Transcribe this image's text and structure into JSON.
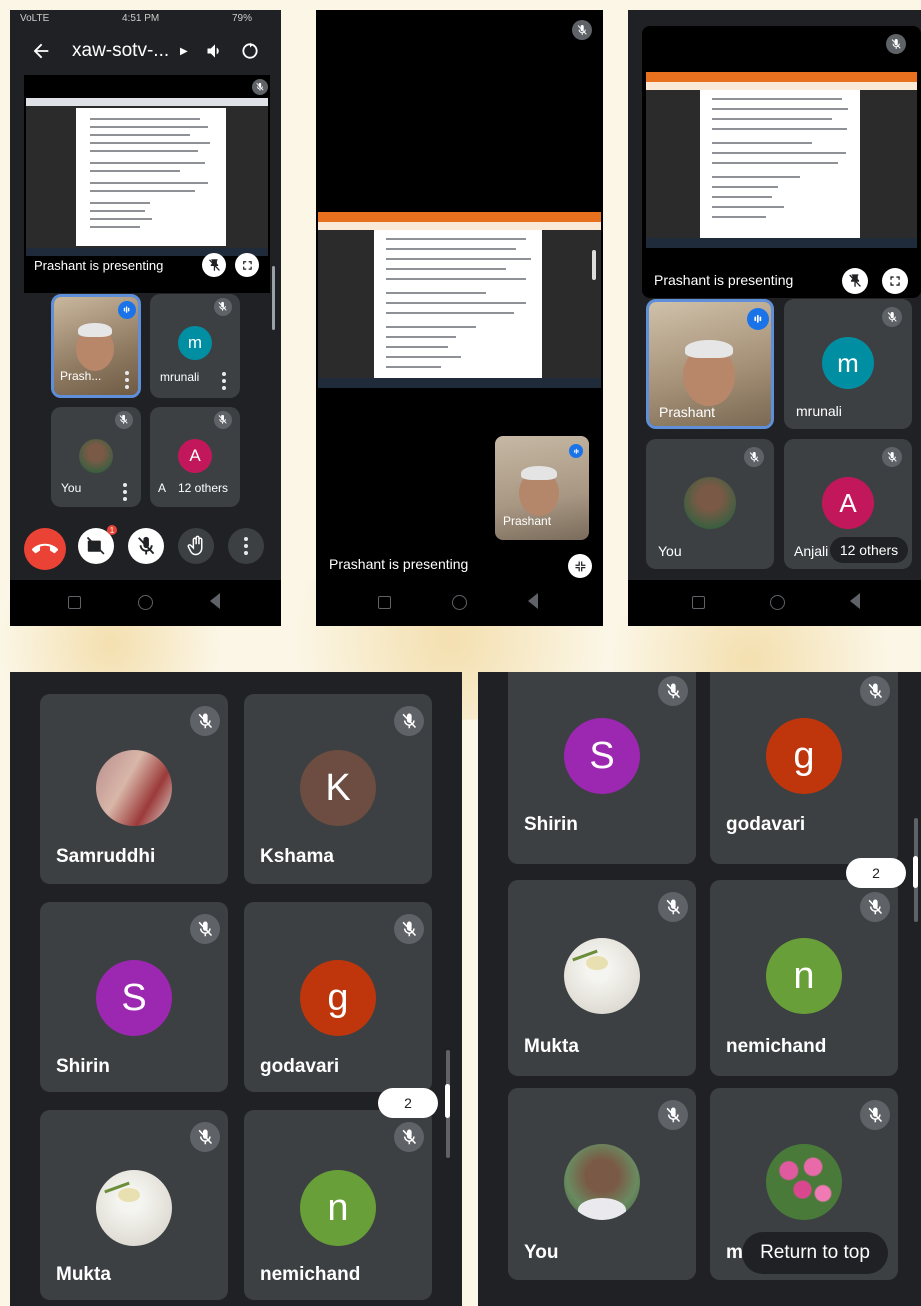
{
  "colors": {
    "meet_dark": "#202124",
    "tile": "#3c4043",
    "mic_grey": "#5f6368",
    "hangup_red": "#ea4335",
    "active_blue": "#1a73e8",
    "avatar_m": "#008fa2",
    "avatar_a": "#c2185b",
    "avatar_k": "#6d4c41",
    "avatar_s": "#9c27b0",
    "avatar_g": "#bf360c",
    "avatar_n": "#689f38"
  },
  "phone1": {
    "status": {
      "carrier": "VoLTE",
      "time": "4:51 PM",
      "battery": "79%"
    },
    "meeting_code": "xaw-sotv-...",
    "presenting_label": "Prashant is presenting",
    "tiles": [
      {
        "name": "Prash...",
        "kind": "photo"
      },
      {
        "name": "mrunali",
        "initial": "m"
      },
      {
        "name": "You",
        "kind": "photo"
      },
      {
        "name": "A",
        "initial": "A",
        "others": "12 others"
      }
    ],
    "controls": [
      "end-call",
      "camera-off",
      "mic-off",
      "raise-hand",
      "more"
    ],
    "camera_badge": "1"
  },
  "phone2": {
    "presenting_label": "Prashant is presenting",
    "pip_name": "Prashant"
  },
  "phone3": {
    "presenting_label": "Prashant is presenting",
    "tiles": [
      {
        "name": "Prashant",
        "kind": "photo"
      },
      {
        "name": "mrunali",
        "initial": "m"
      },
      {
        "name": "You",
        "kind": "photo"
      },
      {
        "name": "Anjali",
        "initial": "A",
        "others": "12 others"
      }
    ]
  },
  "grid_left": {
    "tiles": [
      {
        "name": "Samruddhi",
        "kind": "photo"
      },
      {
        "name": "Kshama",
        "initial": "K"
      },
      {
        "name": "Shirin",
        "initial": "S"
      },
      {
        "name": "godavari",
        "initial": "g"
      },
      {
        "name": "Mukta",
        "kind": "photo"
      },
      {
        "name": "nemichand",
        "initial": "n"
      }
    ],
    "page_badge": "2"
  },
  "grid_right": {
    "tiles": [
      {
        "name": "Shirin",
        "initial": "S"
      },
      {
        "name": "godavari",
        "initial": "g"
      },
      {
        "name": "Mukta",
        "kind": "photo"
      },
      {
        "name": "nemichand",
        "initial": "n"
      },
      {
        "name": "You",
        "kind": "photo"
      },
      {
        "name": "mi",
        "kind": "photo"
      }
    ],
    "page_badge": "2",
    "return_to_top": "Return to top"
  }
}
